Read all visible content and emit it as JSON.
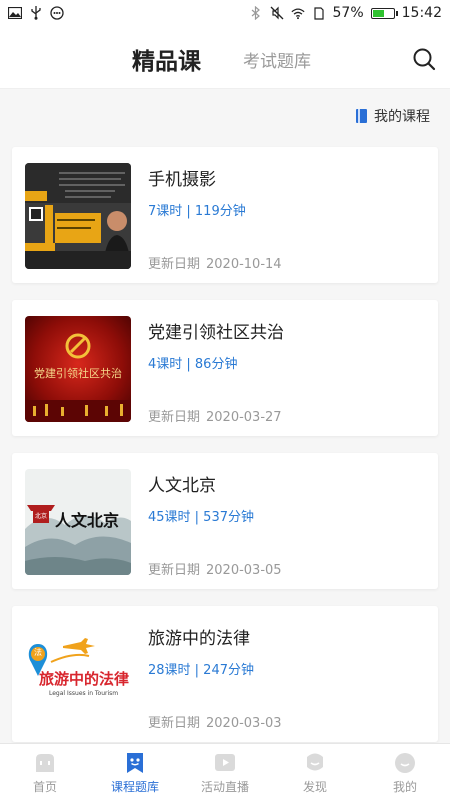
{
  "statusbar": {
    "battery_text": "57%",
    "time": "15:42",
    "battery_level": 0.57
  },
  "header": {
    "tab_active": "精品课",
    "tab_inactive": "考试题库",
    "search_icon": "search-icon"
  },
  "my_course": {
    "label": "我的课程",
    "icon": "book-icon"
  },
  "courses": [
    {
      "title": "手机摄影",
      "meta": "7课时 | 119分钟",
      "date_label": "更新日期",
      "date": "2020-10-14"
    },
    {
      "title": "党建引领社区共治",
      "meta": "4课时 | 86分钟",
      "date_label": "更新日期",
      "date": "2020-03-27",
      "thumb_text": "党建引领社区共治"
    },
    {
      "title": "人文北京",
      "meta": "45课时 | 537分钟",
      "date_label": "更新日期",
      "date": "2020-03-05",
      "thumb_text": "人文北京",
      "thumb_seal": "北京"
    },
    {
      "title": "旅游中的法律",
      "meta": "28课时 | 247分钟",
      "date_label": "更新日期",
      "date": "2020-03-03",
      "thumb_text": "旅游中的法律",
      "thumb_sub": "Legal Issues in Tourism",
      "thumb_badge": "法"
    }
  ],
  "bottom_nav": [
    {
      "label": "首页",
      "icon": "home-icon",
      "active": false
    },
    {
      "label": "课程题库",
      "icon": "course-bank-icon",
      "active": true
    },
    {
      "label": "活动直播",
      "icon": "live-play-icon",
      "active": false
    },
    {
      "label": "发现",
      "icon": "discover-icon",
      "active": false
    },
    {
      "label": "我的",
      "icon": "profile-icon",
      "active": false
    }
  ],
  "colors": {
    "accent": "#2a6fd6",
    "meta_blue": "#2a7ad4",
    "muted": "#999999"
  }
}
